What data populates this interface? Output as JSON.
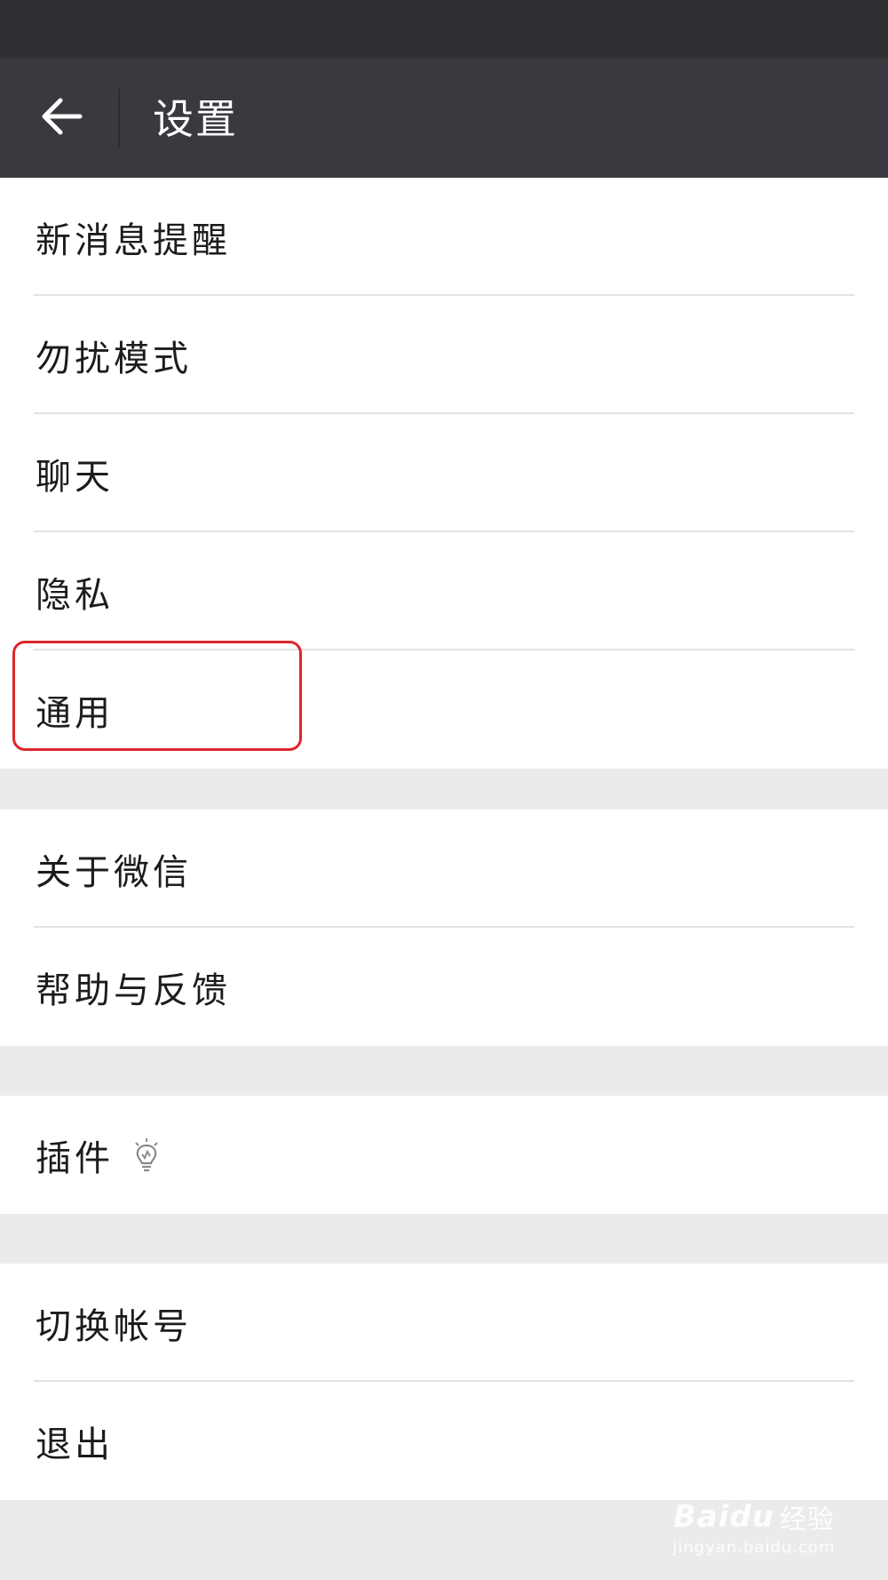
{
  "header": {
    "title": "设置",
    "back_icon": "arrow-left-icon"
  },
  "groups": [
    {
      "items": [
        {
          "label": "新消息提醒"
        },
        {
          "label": "勿扰模式"
        },
        {
          "label": "聊天"
        },
        {
          "label": "隐私"
        },
        {
          "label": "通用",
          "highlighted": true
        }
      ]
    },
    {
      "items": [
        {
          "label": "关于微信"
        },
        {
          "label": "帮助与反馈"
        }
      ]
    },
    {
      "items": [
        {
          "label": "插件",
          "icon": "lightbulb-icon"
        }
      ]
    },
    {
      "items": [
        {
          "label": "切换帐号"
        },
        {
          "label": "退出"
        }
      ]
    }
  ],
  "watermark": {
    "brand": "Baidu",
    "brand_cn": "经验",
    "url": "jingyan.baidu.com"
  },
  "colors": {
    "status_bar": "#2f3034",
    "title_bar": "#393a3f",
    "page_background": "#ebebeb",
    "highlight": "#e0242b"
  }
}
